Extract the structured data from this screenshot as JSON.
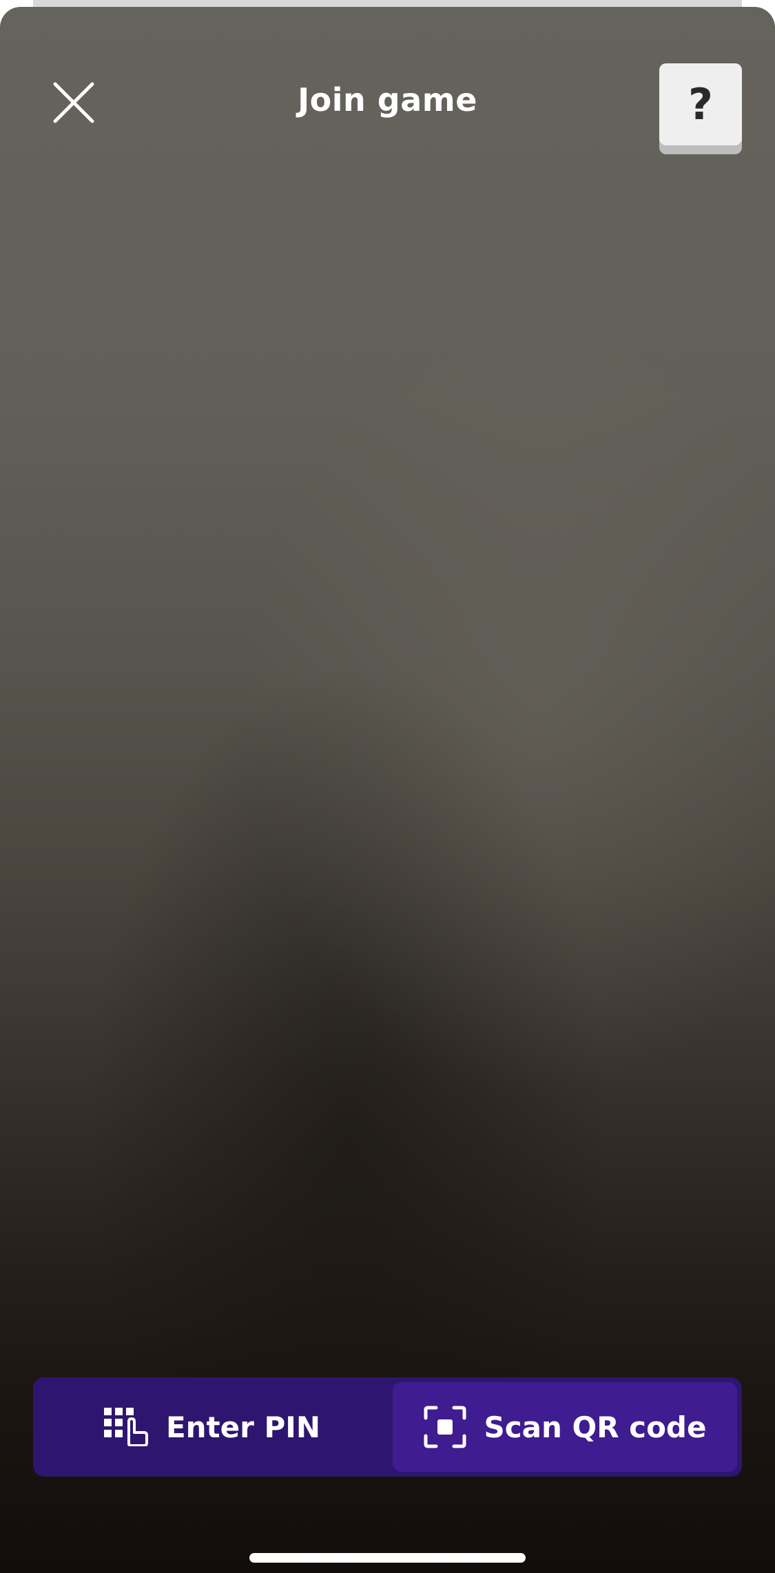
{
  "header": {
    "title": "Join game",
    "help_label": "?"
  },
  "mode_toggle": {
    "enter_pin_label": "Enter PIN",
    "scan_qr_label": "Scan QR code",
    "selected": "Scan QR code"
  },
  "icons": {
    "close": "close-icon",
    "pin": "keypad-tap-icon",
    "qr": "qr-scan-icon"
  },
  "colors": {
    "toggle_background": "#2e1670",
    "toggle_selected": "#3f1c8f",
    "help_button": "#efefef",
    "text": "#ffffff"
  }
}
